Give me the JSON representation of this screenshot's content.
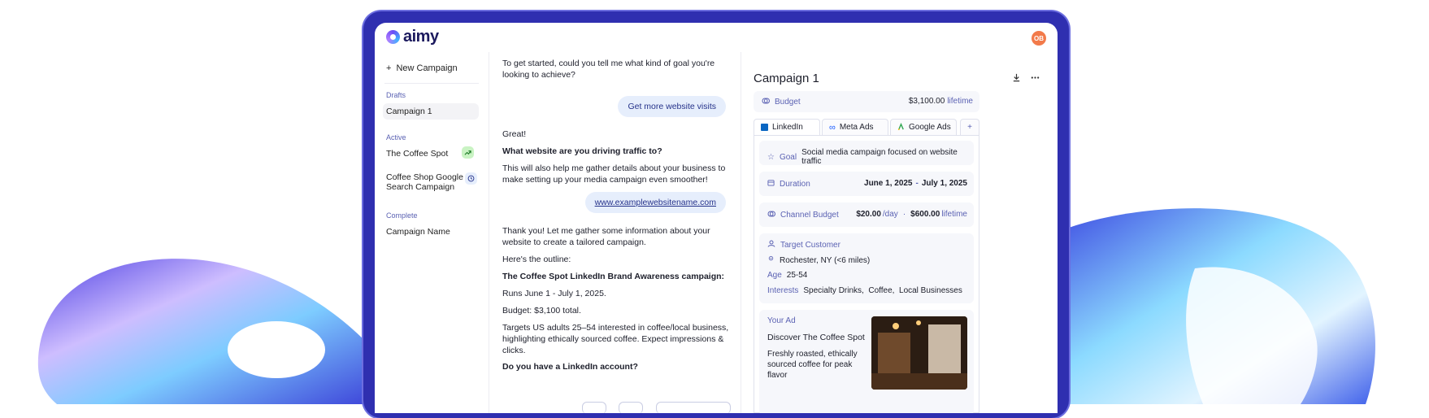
{
  "app": {
    "logo": "aimy",
    "avatar_initials": "OB"
  },
  "sidebar": {
    "new_campaign": "New Campaign",
    "groups": [
      {
        "label": "Drafts",
        "items": [
          {
            "label": "Campaign 1"
          }
        ]
      },
      {
        "label": "Active",
        "items": [
          {
            "label": "The Coffee Spot"
          },
          {
            "label": "Coffee Shop Google Search Campaign"
          }
        ]
      },
      {
        "label": "Complete",
        "items": [
          {
            "label": "Campaign Name"
          }
        ]
      }
    ]
  },
  "chat": {
    "intro": "To get started, could you tell me what kind of goal you're looking to achieve?",
    "reply_goal": "Get more website visits",
    "great": "Great!",
    "question_site": "What website are you driving traffic to?",
    "help_text": "This will also help me gather details about your business to make setting up your media campaign even smoother!",
    "reply_site": "www.examplewebsitename.com",
    "thanks": "Thank you! Let me gather some information about your website to create a tailored campaign.",
    "outline": "Here's the outline:",
    "campaign_title": "The Coffee Spot LinkedIn Brand Awareness campaign:",
    "runs": "Runs June 1 - July 1, 2025.",
    "budget": "Budget: $3,100 total.",
    "targets": "Targets US adults 25–54 interested in coffee/local business, highlighting ethically sourced coffee. Expect impressions & clicks.",
    "question_linkedin": "Do you have a LinkedIn account?"
  },
  "panel": {
    "title": "Campaign 1",
    "budget_label": "Budget",
    "budget_value": "$3,100.00",
    "budget_unit": "lifetime",
    "tabs": [
      "LinkedIn",
      "Meta Ads",
      "Google Ads",
      "+"
    ],
    "goal_label": "Goal",
    "goal_value": "Social media campaign focused on website traffic",
    "duration_label": "Duration",
    "duration_start": "June 1, 2025",
    "duration_sep": "-",
    "duration_end": "July 1, 2025",
    "channel_label": "Channel Budget",
    "channel_day": "$20.00",
    "channel_day_unit": "/day",
    "channel_dot": "·",
    "channel_total": "$600.00",
    "channel_total_unit": "lifetime",
    "target_label": "Target Customer",
    "location": "Rochester, NY (<6 miles)",
    "age_label": "Age",
    "age_value": "25-54",
    "interests_label": "Interests",
    "interests": "Specialty Drinks,  Coffee,  Local Businesses",
    "ad_label": "Your Ad",
    "ad_title": "Discover The Coffee Spot",
    "ad_body": "Freshly roasted, ethically sourced coffee for peak flavor"
  },
  "colors": {
    "device": "#2f2fb0",
    "accent": "#5b62b3",
    "bubble": "#e6eefc",
    "avatar": "#f27a4a"
  }
}
